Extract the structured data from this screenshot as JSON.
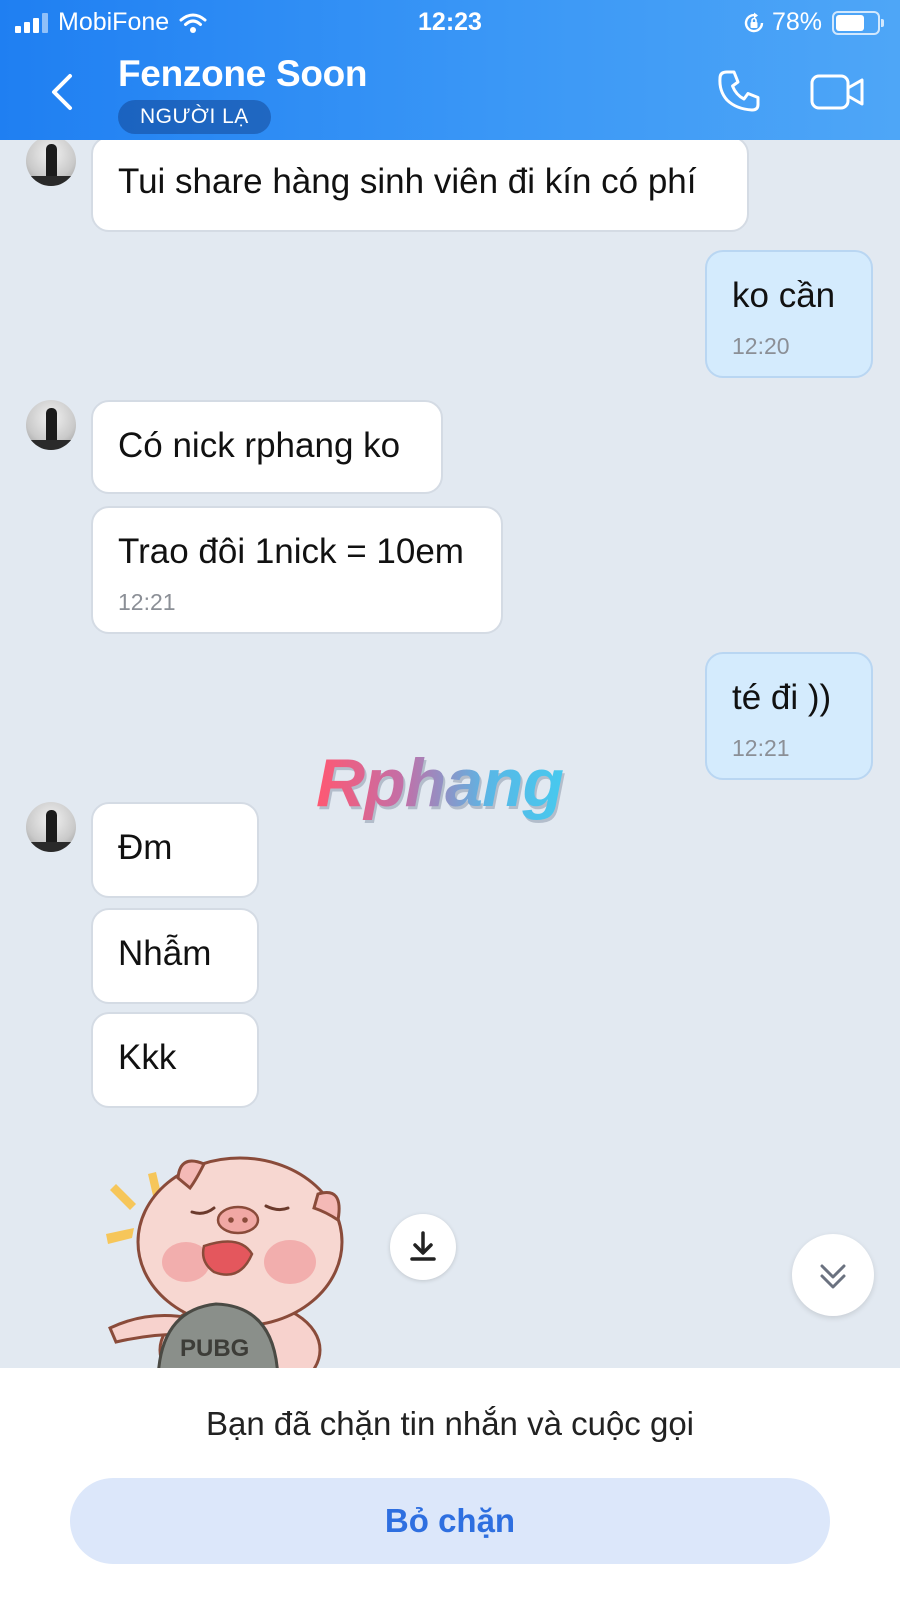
{
  "status_bar": {
    "carrier": "MobiFone",
    "time": "12:23",
    "battery": "78%",
    "battery_level": 0.78
  },
  "header": {
    "contact_name": "Fenzone Soon",
    "badge": "NGƯỜI LẠ",
    "back_icon": "chevron-left-icon",
    "call_icon": "phone-icon",
    "video_icon": "video-camera-icon"
  },
  "messages": [
    {
      "sender": "them",
      "text": "Tui share hàng sinh viên đi kín có phí",
      "time": ""
    },
    {
      "sender": "me",
      "text": "ko cần",
      "time": "12:20"
    },
    {
      "sender": "them",
      "text": "Có nick rphang ko",
      "time": ""
    },
    {
      "sender": "them",
      "text": "Trao đôi 1nick = 10em",
      "time": "12:21"
    },
    {
      "sender": "me",
      "text": "té đi ))",
      "time": "12:21"
    },
    {
      "sender": "them",
      "text": "Đm",
      "time": ""
    },
    {
      "sender": "them",
      "text": "Nhẫm",
      "time": ""
    },
    {
      "sender": "them",
      "text": "Kkk",
      "time": ""
    }
  ],
  "watermark": "Rphang",
  "sticker": {
    "label": "PUBG"
  },
  "footer": {
    "blocked_text": "Bạn đã chặn tin nhắn và cuộc gọi",
    "unblock_label": "Bỏ chặn"
  },
  "colors": {
    "header_start": "#1f7ff2",
    "header_end": "#4ea6f7",
    "chat_bg": "#e2e9f1",
    "my_bubble": "#d4ebfd",
    "unblock_text": "#2e6fe0"
  }
}
